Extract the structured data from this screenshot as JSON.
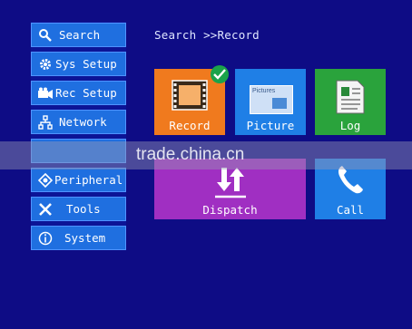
{
  "breadcrumb": "Search >>Record",
  "sidebar": {
    "items": [
      {
        "label": "Search",
        "icon": "search-icon"
      },
      {
        "label": "Sys Setup",
        "icon": "gear-icon"
      },
      {
        "label": "Rec Setup",
        "icon": "camera-icon"
      },
      {
        "label": "Network",
        "icon": "network-icon"
      },
      {
        "label": "",
        "icon": ""
      },
      {
        "label": "Peripheral",
        "icon": "peripheral-icon"
      },
      {
        "label": "Tools",
        "icon": "tools-icon"
      },
      {
        "label": "System",
        "icon": "info-icon"
      }
    ]
  },
  "tiles": {
    "record": {
      "label": "Record",
      "color": "#f07a1e"
    },
    "picture": {
      "label": "Picture",
      "color": "#1f7fe6",
      "icon_text": "Pictures"
    },
    "log": {
      "label": "Log",
      "color": "#2aa33c"
    },
    "dispatch": {
      "label": "Dispatch",
      "color": "#a02fc2"
    },
    "call": {
      "label": "Call",
      "color": "#1f7fe6"
    }
  },
  "watermark": "trade.china.cn"
}
